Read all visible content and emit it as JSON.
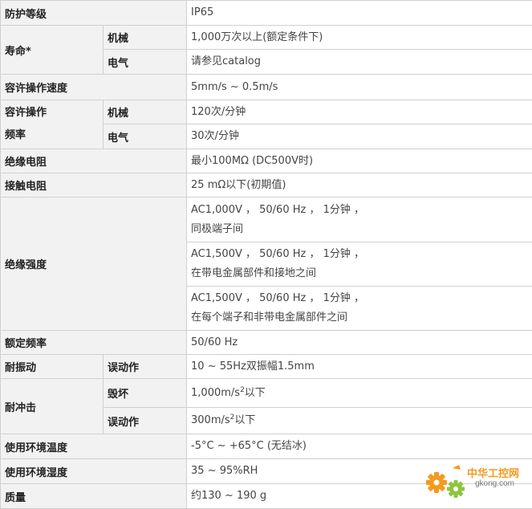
{
  "rows": {
    "protection": {
      "label": "防护等级",
      "value": "IP65"
    },
    "life": {
      "label": "寿命*",
      "mech": {
        "label": "机械",
        "value": "1,000万次以上(额定条件下)"
      },
      "elec": {
        "label": "电气",
        "value": "请参见catalog"
      }
    },
    "speed": {
      "label": "容许操作速度",
      "value": "5mm/s ~ 0.5m/s"
    },
    "freq": {
      "label_line1": "容许操作",
      "label_line2": "频率",
      "mech": {
        "label": "机械",
        "value": "120次/分钟"
      },
      "elec": {
        "label": "电气",
        "value": "30次/分钟"
      }
    },
    "insulation_res": {
      "label": "绝缘电阻",
      "value": "最小100MΩ (DC500V时)"
    },
    "contact_res": {
      "label": "接触电阻",
      "value": "25 mΩ以下(初期值)"
    },
    "dielectric": {
      "label": "绝缘强度",
      "items": [
        {
          "line1": "AC1,000V ， 50/60 Hz ， 1分钟 ，",
          "line2": "同极端子间"
        },
        {
          "line1": "AC1,500V ， 50/60 Hz ， 1分钟 ，",
          "line2": "在带电金属部件和接地之间"
        },
        {
          "line1": "AC1,500V ， 50/60 Hz ， 1分钟 ，",
          "line2": "在每个端子和非带电金属部件之间"
        }
      ]
    },
    "rated_freq": {
      "label": "额定频率",
      "value": "50/60 Hz"
    },
    "vibration": {
      "label": "耐振动",
      "sub_label": "误动作",
      "value": "10 ~ 55Hz双振幅1.5mm"
    },
    "shock": {
      "label": "耐冲击",
      "destruct": {
        "label": "毁坏",
        "value_main": "1,000m/s",
        "sup": "2",
        "suffix": "以下"
      },
      "malfunction": {
        "label": "误动作",
        "value_main": "300m/s",
        "sup": "2",
        "suffix": "以下"
      }
    },
    "temp": {
      "label": "使用环境温度",
      "value": "-5°C ~ +65°C (无结冰)"
    },
    "humidity": {
      "label": "使用环境湿度",
      "value": "35 ~ 95%RH"
    },
    "mass": {
      "label": "质量",
      "value": "约130 ~ 190 g"
    }
  },
  "watermark": {
    "brand": "中华工控网",
    "url": "gkong.com",
    "icon": "gear-icon",
    "colors": {
      "orange": "#f39a1e",
      "green": "#8cc63f"
    }
  }
}
